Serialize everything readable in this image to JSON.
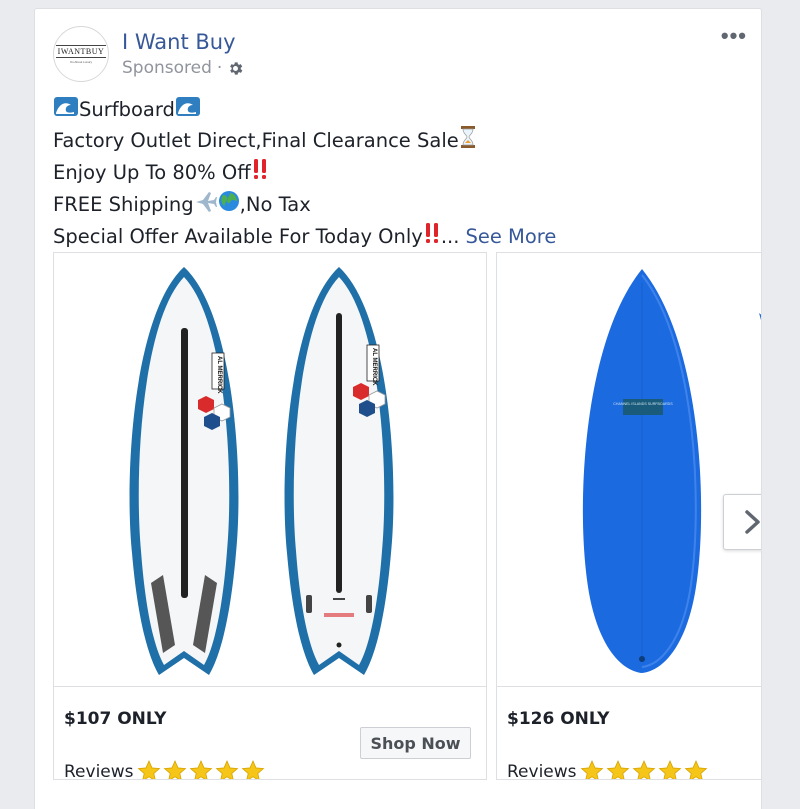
{
  "post": {
    "page_name": "I Want Buy",
    "avatar_text": "IWANTBUY",
    "avatar_subtext": "It's About Luxury",
    "sponsored_label": "Sponsored",
    "meta_separator": "·",
    "more_icon": "ellipsis-icon",
    "more_label": "•••"
  },
  "body_text": {
    "line1": "Surfboard",
    "line2": "Factory Outlet Direct,Final Clearance Sale",
    "line3": "Enjoy Up To 80% Off",
    "line4a": "FREE Shipping",
    "line4b": ",No Tax",
    "line5": "Special Offer Available For Today Only",
    "ellipsis": "...",
    "see_more": "See More"
  },
  "carousel": {
    "cards": [
      {
        "price": "$107 ONLY",
        "reviews_label": "Reviews",
        "rating": 5,
        "cta": "Shop Now",
        "board_brand_text": "AL MERRICK"
      },
      {
        "price": "$126 ONLY",
        "reviews_label": "Reviews",
        "rating": 5,
        "board_brand_text": "CHANNEL ISLANDS SURFBOARDS"
      }
    ],
    "next_icon": "chevron-right-icon"
  },
  "colors": {
    "link": "#365899",
    "board_blue": "#1c6ae0",
    "star": "#f5c518"
  }
}
